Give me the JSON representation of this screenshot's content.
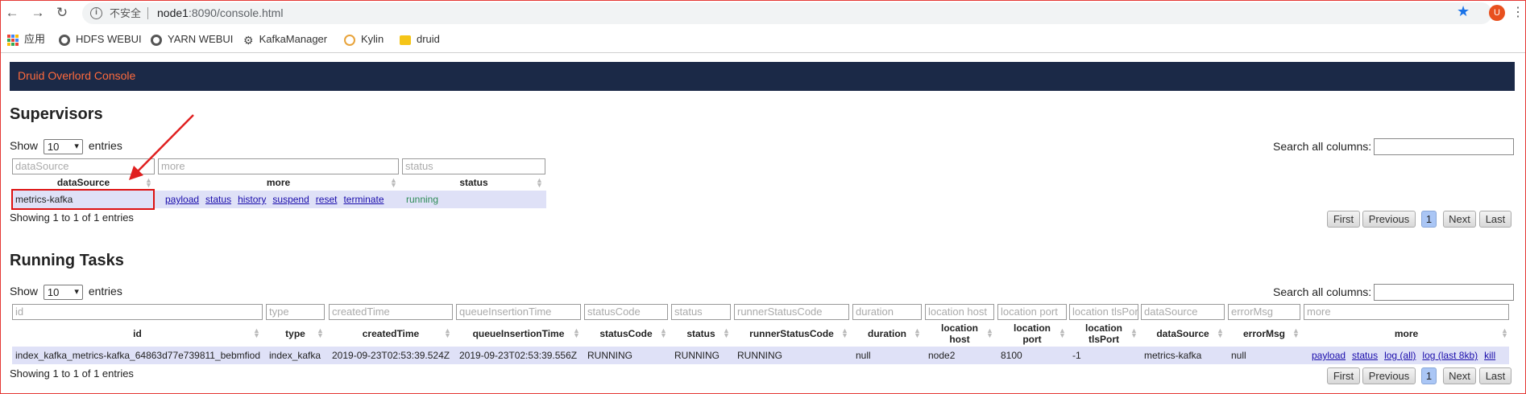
{
  "browser": {
    "insecure_label": "不安全",
    "url_host": "node1",
    "url_rest": ":8090/console.html",
    "profile_initial": "U",
    "bookmarks": [
      {
        "label": "应用",
        "icon": "apps-grid-icon"
      },
      {
        "label": "HDFS WEBUI",
        "icon": "globe-icon"
      },
      {
        "label": "YARN WEBUI",
        "icon": "globe-icon"
      },
      {
        "label": "KafkaManager",
        "icon": "kafka-icon"
      },
      {
        "label": "Kylin",
        "icon": "kylin-icon"
      },
      {
        "label": "druid",
        "icon": "folder-icon"
      }
    ]
  },
  "page": {
    "banner": "Druid Overlord Console"
  },
  "supervisors": {
    "title": "Supervisors",
    "show_prefix": "Show",
    "show_value": "10",
    "show_suffix": "entries",
    "search_label": "Search all columns:",
    "filters": [
      "dataSource",
      "more",
      "status"
    ],
    "headers": [
      "dataSource",
      "more",
      "status"
    ],
    "row": {
      "dataSource": "metrics-kafka",
      "actions": [
        "payload",
        "status",
        "history",
        "suspend",
        "reset",
        "terminate"
      ],
      "status": "running"
    },
    "info": "Showing 1 to 1 of 1 entries",
    "pager": {
      "first": "First",
      "previous": "Previous",
      "page": "1",
      "next": "Next",
      "last": "Last"
    }
  },
  "running_tasks": {
    "title": "Running Tasks",
    "show_prefix": "Show",
    "show_value": "10",
    "show_suffix": "entries",
    "search_label": "Search all columns:",
    "filters": [
      "id",
      "type",
      "createdTime",
      "queueInsertionTime",
      "statusCode",
      "status",
      "runnerStatusCode",
      "duration",
      "location host",
      "location port",
      "location tlsPort",
      "dataSource",
      "errorMsg",
      "more"
    ],
    "headers": [
      {
        "l1": "id",
        "l2": ""
      },
      {
        "l1": "type",
        "l2": ""
      },
      {
        "l1": "createdTime",
        "l2": ""
      },
      {
        "l1": "queueInsertionTime",
        "l2": ""
      },
      {
        "l1": "statusCode",
        "l2": ""
      },
      {
        "l1": "status",
        "l2": ""
      },
      {
        "l1": "runnerStatusCode",
        "l2": ""
      },
      {
        "l1": "duration",
        "l2": ""
      },
      {
        "l1": "location",
        "l2": "host"
      },
      {
        "l1": "location",
        "l2": "port"
      },
      {
        "l1": "location",
        "l2": "tlsPort"
      },
      {
        "l1": "dataSource",
        "l2": ""
      },
      {
        "l1": "errorMsg",
        "l2": ""
      },
      {
        "l1": "more",
        "l2": ""
      }
    ],
    "row": {
      "id": "index_kafka_metrics-kafka_64863d77e739811_bebmfiod",
      "type": "index_kafka",
      "createdTime": "2019-09-23T02:53:39.524Z",
      "queueInsertionTime": "2019-09-23T02:53:39.556Z",
      "statusCode": "RUNNING",
      "status": "RUNNING",
      "runnerStatusCode": "RUNNING",
      "duration": "null",
      "location_host": "node2",
      "location_port": "8100",
      "location_tlsPort": "-1",
      "dataSource": "metrics-kafka",
      "errorMsg": "null",
      "actions": [
        "payload",
        "status",
        "log (all)",
        "log (last 8kb)",
        "kill"
      ]
    },
    "info": "Showing 1 to 1 of 1 entries",
    "pager": {
      "first": "First",
      "previous": "Previous",
      "page": "1",
      "next": "Next",
      "last": "Last"
    }
  }
}
